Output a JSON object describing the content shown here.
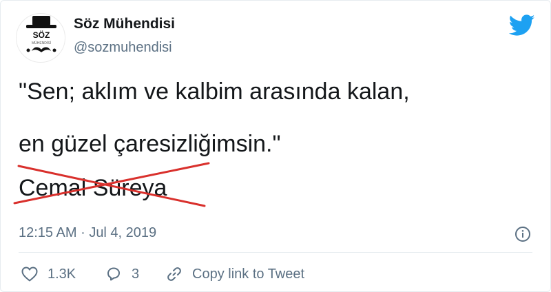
{
  "user": {
    "display_name": "Söz Mühendisi",
    "handle": "@sozmuhendisi",
    "avatar_text": "SÖZ",
    "avatar_subtext": "MÜHENDİSİ"
  },
  "tweet": {
    "lines": [
      "\"Sen; aklım ve kalbim arasında kalan,",
      "en güzel çaresizliğimsin.\""
    ],
    "author": "Cemal Süreya"
  },
  "meta": {
    "time": "12:15 AM",
    "separator": "·",
    "date": "Jul 4, 2019"
  },
  "actions": {
    "likes": "1.3K",
    "replies": "3",
    "copy_link_label": "Copy link to Tweet"
  },
  "colors": {
    "twitter_blue": "#1da1f2",
    "strike_red": "#d9302c",
    "muted": "#5b7083",
    "text": "#14171a"
  },
  "icons": [
    "twitter-bird-icon",
    "info-icon",
    "heart-icon",
    "reply-bubble-icon",
    "link-icon"
  ]
}
